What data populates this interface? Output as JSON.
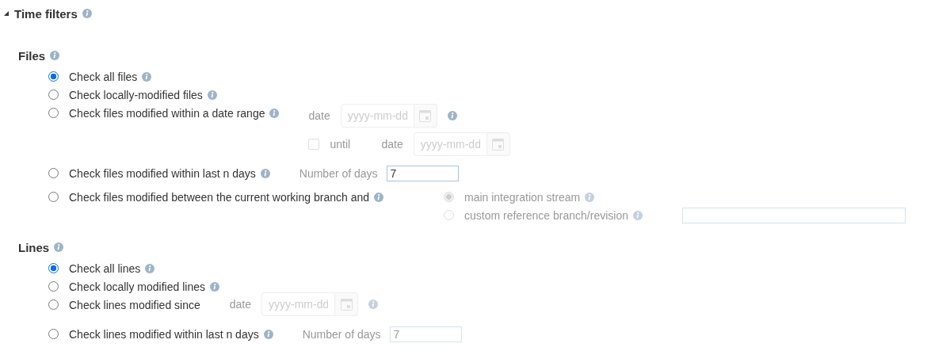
{
  "section": {
    "title": "Time filters",
    "expanded": true,
    "info": true
  },
  "groups": [
    {
      "title": "Files",
      "info": true,
      "options": [
        {
          "kind": "plain",
          "label": "Check all files",
          "selected": true,
          "info": true
        },
        {
          "kind": "plain",
          "label": "Check locally-modified files",
          "selected": false,
          "info": true
        },
        {
          "kind": "date_range",
          "label": "Check files modified within a date range",
          "selected": false,
          "info": true,
          "date_label": "date",
          "date_placeholder": "yyyy-mm-dd",
          "date_info": true,
          "until": {
            "label": "until",
            "checked": false,
            "date_label": "date",
            "date_placeholder": "yyyy-mm-dd"
          }
        },
        {
          "kind": "last_days",
          "label": "Check files modified within last n days",
          "selected": false,
          "info": true,
          "days_label": "Number of days",
          "days_value": "7",
          "disabled": false
        },
        {
          "kind": "branch",
          "label": "Check files modified between the current working branch and",
          "selected": false,
          "info": true,
          "choices": [
            {
              "label": "main integration stream",
              "selected": true,
              "disabled": true,
              "info": true,
              "has_input": false
            },
            {
              "label": "custom reference branch/revision",
              "selected": false,
              "disabled": true,
              "info": true,
              "has_input": true
            }
          ]
        }
      ]
    },
    {
      "title": "Lines",
      "info": true,
      "options": [
        {
          "kind": "plain",
          "label": "Check all lines",
          "selected": true,
          "info": true
        },
        {
          "kind": "plain",
          "label": "Check locally modified lines",
          "selected": false,
          "info": true
        },
        {
          "kind": "since",
          "label": "Check lines modified since",
          "selected": false,
          "info": false,
          "date_label": "date",
          "date_placeholder": "yyyy-mm-dd",
          "date_info": true
        },
        {
          "kind": "last_days",
          "label": "Check lines modified within last n days",
          "selected": false,
          "info": true,
          "days_label": "Number of days",
          "days_value": "7",
          "disabled": true
        }
      ]
    }
  ]
}
